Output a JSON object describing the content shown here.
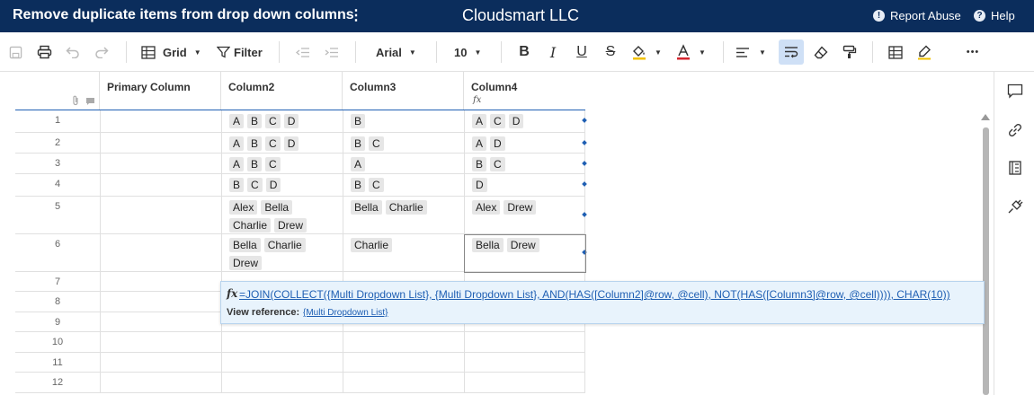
{
  "header": {
    "sheet_title": "Remove duplicate items from drop down columns",
    "kebab": "⋮",
    "company": "Cloudsmart LLC",
    "report_abuse": "Report Abuse",
    "help": "Help"
  },
  "toolbar": {
    "view": "Grid",
    "filter": "Filter",
    "font": "Arial",
    "font_size": "10",
    "bold": "B",
    "italic": "I",
    "underline": "U",
    "strike": "S",
    "more": "•••"
  },
  "columns": [
    "Primary Column",
    "Column2",
    "Column3",
    "Column4"
  ],
  "formula_col_icon": "fx",
  "rows": [
    {
      "num": "1",
      "c2": [
        "A",
        "B",
        "C",
        "D"
      ],
      "c3": [
        "B"
      ],
      "c4": [
        "A",
        "C",
        "D"
      ]
    },
    {
      "num": "2",
      "c2": [
        "A",
        "B",
        "C",
        "D"
      ],
      "c3": [
        "B",
        "C"
      ],
      "c4": [
        "A",
        "D"
      ]
    },
    {
      "num": "3",
      "c2": [
        "A",
        "B",
        "C"
      ],
      "c3": [
        "A"
      ],
      "c4": [
        "B",
        "C"
      ]
    },
    {
      "num": "4",
      "c2": [
        "B",
        "C",
        "D"
      ],
      "c3": [
        "B",
        "C"
      ],
      "c4": [
        "D"
      ]
    },
    {
      "num": "5",
      "c2": [
        "Alex",
        "Bella",
        "Charlie",
        "Drew"
      ],
      "c3": [
        "Bella",
        "Charlie"
      ],
      "c4": [
        "Alex",
        "Drew"
      ]
    },
    {
      "num": "6",
      "c2": [
        "Bella",
        "Charlie",
        "Drew"
      ],
      "c3": [
        "Charlie"
      ],
      "c4": [
        "Bella",
        "Drew"
      ]
    },
    {
      "num": "7",
      "c2": [],
      "c3": [],
      "c4": []
    },
    {
      "num": "8",
      "c2": [],
      "c3": [],
      "c4": []
    },
    {
      "num": "9",
      "c2": [],
      "c3": [],
      "c4": []
    },
    {
      "num": "10",
      "c2": [],
      "c3": [],
      "c4": []
    },
    {
      "num": "11",
      "c2": [],
      "c3": [],
      "c4": []
    },
    {
      "num": "12",
      "c2": [],
      "c3": [],
      "c4": []
    }
  ],
  "formula_popup": {
    "fx": "fx",
    "formula": "=JOIN(COLLECT({Multi Dropdown List}, {Multi Dropdown List}, AND(HAS([Column2]@row, @cell), NOT(HAS([Column3]@row, @cell)))), CHAR(10))",
    "view_reference_label": "View reference:",
    "view_reference_link": "{Multi Dropdown List}"
  },
  "colors": {
    "header_bg": "#0b2d5c",
    "accent": "#1f5fb3",
    "chip_bg": "#e6e6e6",
    "popup_bg": "#e8f3fc"
  }
}
